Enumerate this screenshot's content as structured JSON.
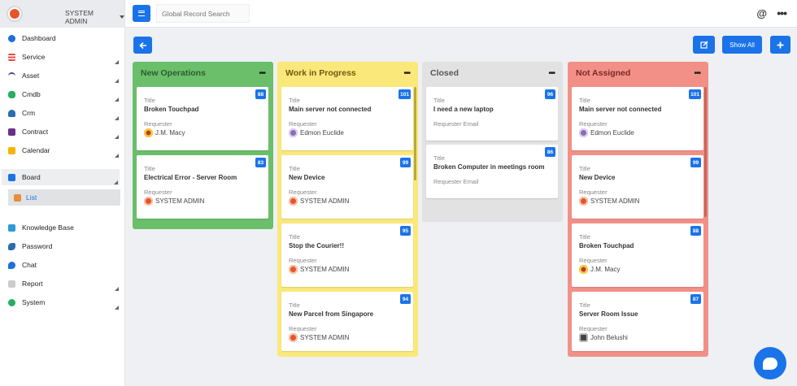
{
  "header": {
    "user_name": "SYSTEM ADMIN",
    "search_placeholder": "Global Record Search"
  },
  "sidebar": {
    "items": [
      {
        "label": "Dashboard",
        "icon": "dashboard-icon",
        "color": "#1e6fd9"
      },
      {
        "label": "Service",
        "icon": "service-icon",
        "color": "#e74c3c"
      },
      {
        "label": "Asset",
        "icon": "wifi-icon",
        "color": "#2c3e9b"
      },
      {
        "label": "Cmdb",
        "icon": "database-icon",
        "color": "#27ae60"
      },
      {
        "label": "Crm",
        "icon": "user-icon",
        "color": "#2b6cb0"
      },
      {
        "label": "Contract",
        "icon": "contract-icon",
        "color": "#6b2f8a"
      },
      {
        "label": "Calendar",
        "icon": "calendar-icon",
        "color": "#f5b400"
      },
      {
        "label": "Board",
        "icon": "board-icon",
        "color": "#1a73e8"
      },
      {
        "label": "List",
        "icon": "list-icon",
        "color": "#e67e22"
      },
      {
        "label": "Knowledge Base",
        "icon": "knowledge-icon",
        "color": "#2b9cd8"
      },
      {
        "label": "Password",
        "icon": "key-icon",
        "color": "#2b6cb0"
      },
      {
        "label": "Chat",
        "icon": "chat-icon",
        "color": "#1e6fd9"
      },
      {
        "label": "Report",
        "icon": "report-icon",
        "color": "#aaaaaa"
      },
      {
        "label": "System",
        "icon": "globe-icon",
        "color": "#27ae60"
      }
    ]
  },
  "toolbar": {
    "show_all_label": "Show All",
    "back_icon": "arrow-left-icon",
    "edit_icon": "edit-icon",
    "add_icon": "plus-icon"
  },
  "board": {
    "columns": [
      {
        "title": "New Operations",
        "color": "#6bbf6b",
        "cards": [
          {
            "id": "88",
            "label": "Title",
            "title": "Broken Touchpad",
            "req_label": "Requester",
            "requester": "J.M. Macy"
          },
          {
            "id": "83",
            "label": "Title",
            "title": "Electrical Error - Server Room",
            "req_label": "Requester",
            "requester": "SYSTEM ADMIN"
          }
        ]
      },
      {
        "title": "Work in Progress",
        "color": "#fbe87a",
        "cards": [
          {
            "id": "101",
            "label": "Title",
            "title": "Main server not connected",
            "req_label": "Requester",
            "requester": "Edmon Euclide"
          },
          {
            "id": "99",
            "label": "Title",
            "title": "New Device",
            "req_label": "Requester",
            "requester": "SYSTEM ADMIN"
          },
          {
            "id": "95",
            "label": "Title",
            "title": "Stop the Courier!!",
            "req_label": "Requester",
            "requester": "SYSTEM ADMIN"
          },
          {
            "id": "94",
            "label": "Title",
            "title": "New Parcel from Singapore",
            "req_label": "Requester",
            "requester": "SYSTEM ADMIN"
          }
        ]
      },
      {
        "title": "Closed",
        "color": "#e2e2e2",
        "cards": [
          {
            "id": "96",
            "label": "Title",
            "title": "I need a new laptop",
            "req_label": "Requester Email"
          },
          {
            "id": "86",
            "label": "Title",
            "title": "Broken Computer in meetings room",
            "req_label": "Requester Email"
          }
        ]
      },
      {
        "title": "Not Assigned",
        "color": "#f29088",
        "cards": [
          {
            "id": "101",
            "label": "Title",
            "title": "Main server not connected",
            "req_label": "Requester",
            "requester": "Edmon Euclide"
          },
          {
            "id": "99",
            "label": "Title",
            "title": "New Device",
            "req_label": "Requester",
            "requester": "SYSTEM ADMIN"
          },
          {
            "id": "88",
            "label": "Title",
            "title": "Broken Touchpad",
            "req_label": "Requester",
            "requester": "J.M. Macy"
          },
          {
            "id": "87",
            "label": "Title",
            "title": "Server Room Issue",
            "req_label": "Requester",
            "requester": "John Belushi"
          }
        ]
      }
    ]
  }
}
